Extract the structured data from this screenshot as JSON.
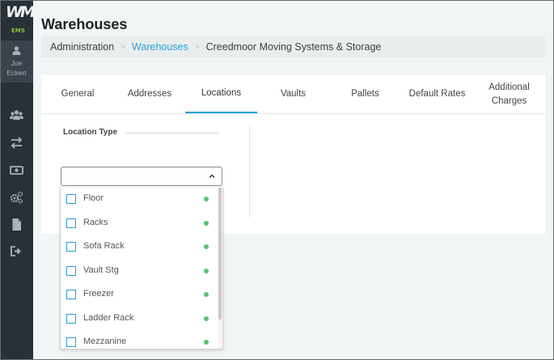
{
  "app": {
    "logo_text": "WM",
    "logo_sub": "EMS",
    "user_first": "Joe",
    "user_last": "Eckert",
    "accent_color": "#2a9fd6",
    "status_color": "#5cc16a"
  },
  "sidebar": {
    "nav": [
      {
        "icon": "users-icon"
      },
      {
        "icon": "transfer-icon"
      },
      {
        "icon": "money-icon"
      },
      {
        "icon": "settings-icon"
      },
      {
        "icon": "document-icon"
      },
      {
        "icon": "logout-icon"
      }
    ]
  },
  "page": {
    "title": "Warehouses"
  },
  "breadcrumb": {
    "root": "Administration",
    "section": "Warehouses",
    "current": "Creedmoor Moving Systems & Storage"
  },
  "tabs": [
    {
      "label": "General"
    },
    {
      "label": "Addresses"
    },
    {
      "label": "Locations",
      "active": true
    },
    {
      "label": "Vaults"
    },
    {
      "label": "Pallets"
    },
    {
      "label": "Default Rates"
    },
    {
      "label": "Additional Charges"
    }
  ],
  "locations": {
    "type_label": "Location Type",
    "select_value": "",
    "options": [
      {
        "label": "Floor",
        "checked": false,
        "active": true
      },
      {
        "label": "Racks",
        "checked": false,
        "active": true
      },
      {
        "label": "Sofa Rack",
        "checked": false,
        "active": true
      },
      {
        "label": "Vault Stg",
        "checked": false,
        "active": true
      },
      {
        "label": "Freezer",
        "checked": false,
        "active": true
      },
      {
        "label": "Ladder Rack",
        "checked": false,
        "active": true
      },
      {
        "label": "Mezzanine",
        "checked": false,
        "active": true
      }
    ]
  }
}
